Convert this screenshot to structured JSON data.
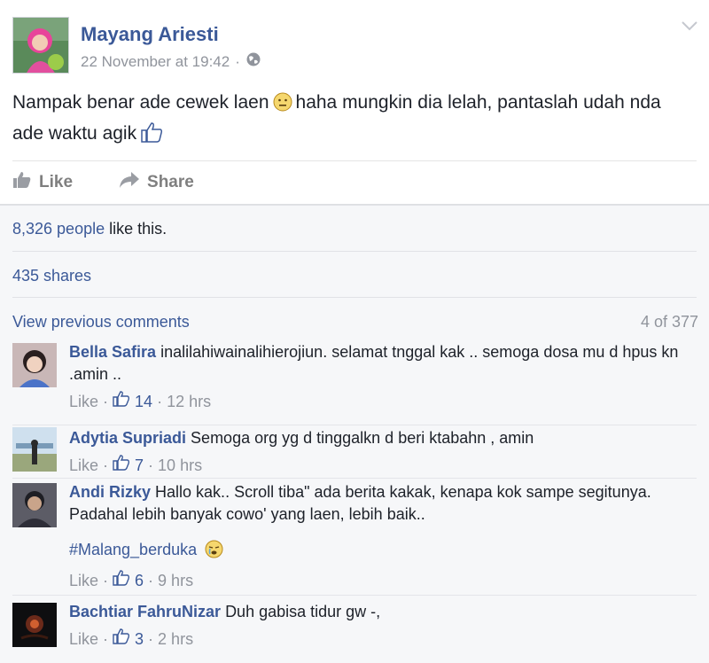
{
  "post": {
    "author": "Mayang Ariesti",
    "timestamp": "22 November at 19:42",
    "privacy_separator": "·",
    "text_part1": "Nampak benar ade cewek laen",
    "text_part2": "haha mungkin dia lelah, pantaslah udah nda ade waktu agik",
    "actions": {
      "like_label": "Like",
      "share_label": "Share"
    }
  },
  "ufi": {
    "likes_count": "8,326 people",
    "likes_suffix": " like this.",
    "shares": "435 shares",
    "view_previous": "View previous comments",
    "comment_count": "4 of 377"
  },
  "comments": [
    {
      "name": "Bella Safira",
      "text": "inalilahiwainalihierojiun. selamat tnggal kak .. semoga dosa mu d hpus kn .amin ..",
      "like_label": "Like",
      "likes": "14",
      "time": "12 hrs"
    },
    {
      "name": "Adytia Supriadi",
      "text": "Semoga org yg d tinggalkn d beri ktabahn , amin",
      "like_label": "Like",
      "likes": "7",
      "time": "10 hrs"
    },
    {
      "name": "Andi Rizky",
      "text": "Hallo kak.. Scroll tiba\" ada berita kakak, kenapa kok sampe segitunya. Padahal lebih banyak cowo' yang laen, lebih baik..",
      "hashtag": "#Malang_berduka",
      "like_label": "Like",
      "likes": "6",
      "time": "9 hrs"
    },
    {
      "name": "Bachtiar FahruNizar",
      "text": "Duh gabisa tidur gw -,",
      "like_label": "Like",
      "likes": "3",
      "time": "2 hrs"
    }
  ],
  "colors": {
    "link": "#3b5998",
    "muted": "#90949c",
    "ufi_bg": "#f6f7f9"
  },
  "icons": [
    "globe-icon",
    "chevron-down-icon",
    "thumbs-up-icon",
    "share-arrow-icon",
    "sad-emoji-icon",
    "crying-emoji-icon"
  ]
}
